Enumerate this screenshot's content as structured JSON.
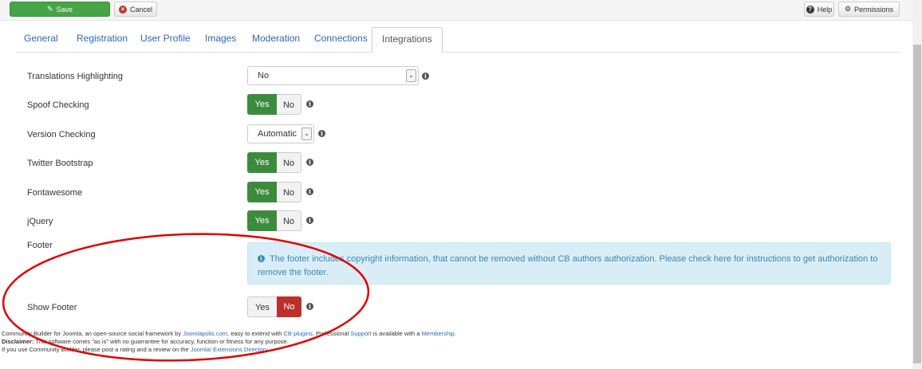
{
  "toolbar": {
    "save_label": "Save",
    "cancel_label": "Cancel",
    "help_label": "Help",
    "permissions_label": "Permissions"
  },
  "tabs": [
    {
      "label": "General"
    },
    {
      "label": "Registration"
    },
    {
      "label": "User Profile"
    },
    {
      "label": "Images"
    },
    {
      "label": "Moderation"
    },
    {
      "label": "Connections"
    },
    {
      "label": "Integrations",
      "active": true
    }
  ],
  "settings": {
    "translations_highlighting": {
      "label": "Translations Highlighting",
      "value": "No"
    },
    "spoof_checking": {
      "label": "Spoof Checking",
      "yes": "Yes",
      "no": "No",
      "selected": "Yes"
    },
    "version_checking": {
      "label": "Version Checking",
      "value": "Automatic"
    },
    "twitter_bootstrap": {
      "label": "Twitter Bootstrap",
      "yes": "Yes",
      "no": "No",
      "selected": "Yes"
    },
    "fontawesome": {
      "label": "Fontawesome",
      "yes": "Yes",
      "no": "No",
      "selected": "Yes"
    },
    "jquery": {
      "label": "jQuery",
      "yes": "Yes",
      "no": "No",
      "selected": "Yes"
    },
    "footer": {
      "label": "Footer",
      "notice": "The footer includes copyright information, that cannot be removed without CB authors authorization. Please check here for instructions to get authorization to remove the footer."
    },
    "show_footer": {
      "label": "Show Footer",
      "yes": "Yes",
      "no": "No",
      "selected": "No"
    }
  },
  "footer": {
    "line1_a": "Community Builder for Joomla, an open-source social framework by ",
    "line1_link1": "Joomlapolis.com",
    "line1_b": ", easy to extend with ",
    "line1_link2": "CB plugins",
    "line1_c": ". Professional ",
    "line1_link3": "Support",
    "line1_d": " is available with a ",
    "line1_link4": "Membership",
    "line1_e": ".",
    "line2_bold": "Disclaimer:",
    "line2_text": " This software comes \"as is\" with no guarrantee for accuracy, function or fitness for any purpose.",
    "line3_a": "If you use Community Builder, please post a rating and a review on the ",
    "line3_link": "Joomla! Extensions Directory",
    "line3_b": "."
  },
  "colors": {
    "annotation_ellipse": "#e00000",
    "yes_active": "#3c8b3c",
    "no_active": "#bd2f2a",
    "link": "#2a69b8"
  }
}
